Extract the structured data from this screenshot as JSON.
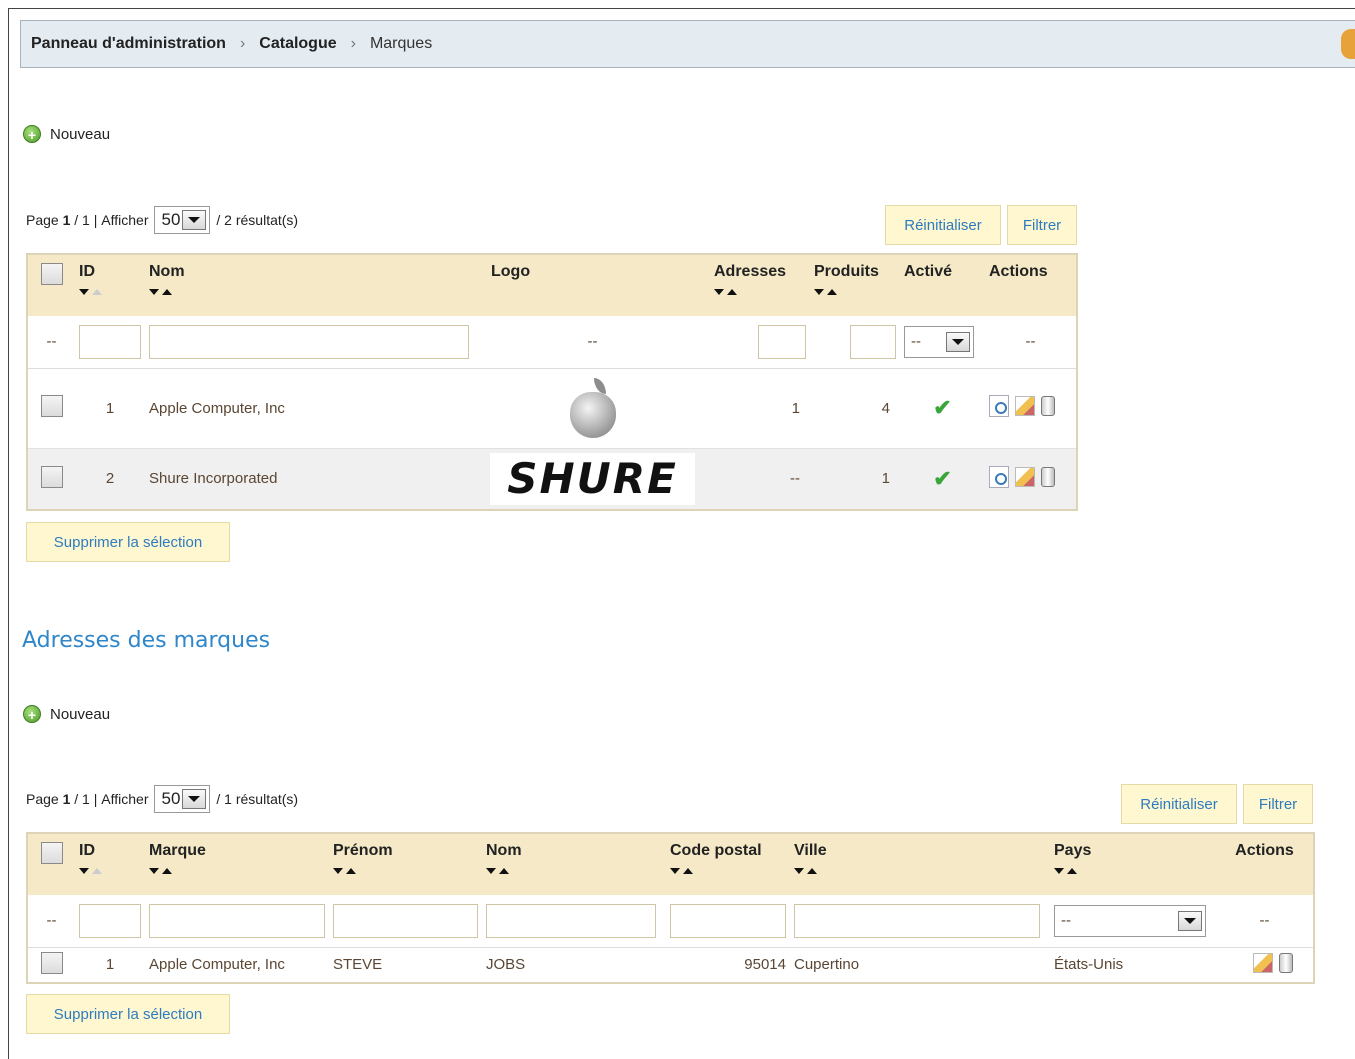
{
  "breadcrumb": {
    "items": [
      "Panneau d'administration",
      "Catalogue",
      "Marques"
    ],
    "separator": "›"
  },
  "brands": {
    "new_label": "Nouveau",
    "pager": {
      "page_word": "Page",
      "current": "1",
      "total": "/ 1 |",
      "show_label": "Afficher",
      "per_page": "50",
      "results": "/ 2 résultat(s)"
    },
    "reset_label": "Réinitialiser",
    "filter_label": "Filtrer",
    "columns": {
      "id": "ID",
      "name": "Nom",
      "logo": "Logo",
      "addresses": "Adresses",
      "products": "Produits",
      "active": "Activé",
      "actions": "Actions"
    },
    "filter_row": {
      "dash": "--",
      "active_select": "--"
    },
    "rows": [
      {
        "id": "1",
        "name": "Apple Computer, Inc",
        "logo": "apple-logo",
        "addresses": "1",
        "products": "4",
        "active": "✔"
      },
      {
        "id": "2",
        "name": "Shure Incorporated",
        "logo": "shure-logo",
        "logo_text": "SHURE",
        "addresses": "--",
        "products": "1",
        "active": "✔"
      }
    ],
    "delete_selection": "Supprimer la sélection"
  },
  "addresses": {
    "title": "Adresses des marques",
    "new_label": "Nouveau",
    "pager": {
      "page_word": "Page",
      "current": "1",
      "total": "/ 1 |",
      "show_label": "Afficher",
      "per_page": "50",
      "results": "/ 1 résultat(s)"
    },
    "reset_label": "Réinitialiser",
    "filter_label": "Filtrer",
    "columns": {
      "id": "ID",
      "brand": "Marque",
      "firstname": "Prénom",
      "lastname": "Nom",
      "postcode": "Code postal",
      "city": "Ville",
      "country": "Pays",
      "actions": "Actions"
    },
    "filter_row": {
      "dash": "--",
      "country_select": "--"
    },
    "rows": [
      {
        "id": "1",
        "brand": "Apple Computer, Inc",
        "firstname": "STEVE",
        "lastname": "JOBS",
        "postcode": "95014",
        "city": "Cupertino",
        "country": "États-Unis"
      }
    ],
    "delete_selection": "Supprimer la sélection"
  },
  "colors": {
    "accent": "#2f86c9",
    "header_bg": "#f5e9c8",
    "button_bg": "#fff7cf",
    "active_check": "#3aa63a"
  }
}
